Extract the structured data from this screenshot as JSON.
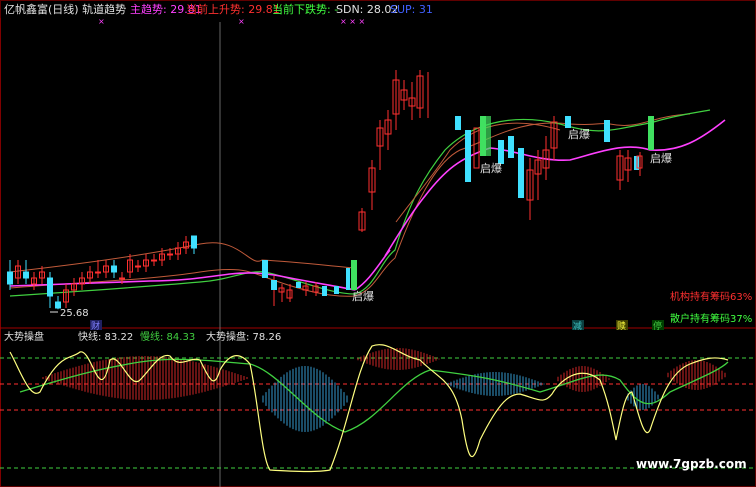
{
  "top_header": {
    "title": "亿帆鑫富(日线) 轨道趋势",
    "items": [
      {
        "label": "主趋势: 29.81",
        "color": "#ff40ff"
      },
      {
        "label": "当前上升势: 29.81",
        "color": "#ff3030"
      },
      {
        "label": "当前下跌势: -",
        "color": "#40ff40"
      },
      {
        "label": "SDN: 28.02",
        "color": "#e0e0e0"
      },
      {
        "label": "SUP: 31",
        "color": "#4060ff"
      }
    ]
  },
  "price_panel": {
    "low_label": "25.68",
    "burst_labels": [
      "启爆",
      "启爆",
      "启爆",
      "启爆"
    ],
    "chip_labels": [
      {
        "text": "机构持有筹码63%",
        "color": "#ff3030"
      },
      {
        "text": "散户持有筹码37%",
        "color": "#40ff40"
      }
    ],
    "flag_labels": [
      {
        "text": "财",
        "color": "#8080ff"
      },
      {
        "text": "减",
        "color": "#40c0c0"
      },
      {
        "text": "赎",
        "color": "#ffff40"
      },
      {
        "text": "停",
        "color": "#40c040"
      }
    ]
  },
  "sub_header": {
    "title": "大势操盘",
    "fast": "快线: 83.22",
    "slow": "慢线: 84.33",
    "value": "大势操盘: 78.26"
  },
  "watermark": "www.7gpzb.com",
  "colors": {
    "up": "#ff3030",
    "down": "#40e0ff",
    "ma_magenta": "#ff40ff",
    "ma_green": "#40d040",
    "ma_brown": "#c05a3a",
    "fast": "#ffff80",
    "slow": "#40d040"
  },
  "chart_data": {
    "type": "candlestick",
    "price_range": [
      25.68,
      31.0
    ],
    "panels": [
      "price",
      "indicator"
    ],
    "candles": [
      {
        "o": 26.3,
        "c": 26.1,
        "h": 26.5,
        "l": 26.0
      },
      {
        "o": 26.2,
        "c": 26.4,
        "h": 26.5,
        "l": 26.1
      },
      {
        "o": 26.3,
        "c": 26.2,
        "h": 26.5,
        "l": 26.1
      },
      {
        "o": 26.1,
        "c": 26.2,
        "h": 26.3,
        "l": 26.0
      },
      {
        "o": 26.2,
        "c": 26.3,
        "h": 26.4,
        "l": 26.1
      },
      {
        "o": 26.2,
        "c": 25.9,
        "h": 26.3,
        "l": 25.7
      },
      {
        "o": 25.8,
        "c": 25.7,
        "h": 25.9,
        "l": 25.68
      },
      {
        "o": 25.8,
        "c": 26.0,
        "h": 26.1,
        "l": 25.7
      },
      {
        "o": 26.0,
        "c": 26.1,
        "h": 26.2,
        "l": 25.9
      },
      {
        "o": 26.1,
        "c": 26.2,
        "h": 26.3,
        "l": 26.0
      },
      {
        "o": 26.2,
        "c": 26.3,
        "h": 26.4,
        "l": 26.1
      },
      {
        "o": 26.3,
        "c": 26.3,
        "h": 26.5,
        "l": 26.2
      },
      {
        "o": 26.3,
        "c": 26.4,
        "h": 26.5,
        "l": 26.2
      },
      {
        "o": 26.4,
        "c": 26.3,
        "h": 26.5,
        "l": 26.2
      },
      {
        "o": 26.2,
        "c": 26.2,
        "h": 26.3,
        "l": 26.1
      },
      {
        "o": 26.3,
        "c": 26.5,
        "h": 26.6,
        "l": 26.2
      },
      {
        "o": 26.4,
        "c": 26.4,
        "h": 26.5,
        "l": 26.3
      },
      {
        "o": 26.4,
        "c": 26.5,
        "h": 26.6,
        "l": 26.3
      },
      {
        "o": 26.5,
        "c": 26.5,
        "h": 26.6,
        "l": 26.4
      },
      {
        "o": 26.5,
        "c": 26.6,
        "h": 26.7,
        "l": 26.4
      },
      {
        "o": 26.6,
        "c": 26.6,
        "h": 26.7,
        "l": 26.5
      },
      {
        "o": 26.6,
        "c": 26.7,
        "h": 26.8,
        "l": 26.5
      },
      {
        "o": 26.7,
        "c": 26.8,
        "h": 26.9,
        "l": 26.6
      },
      {
        "o": 26.9,
        "c": 26.7,
        "h": 26.9,
        "l": 26.6
      }
    ],
    "fast_line_range": [
      0,
      100
    ],
    "slow_line_range": [
      0,
      100
    ]
  }
}
